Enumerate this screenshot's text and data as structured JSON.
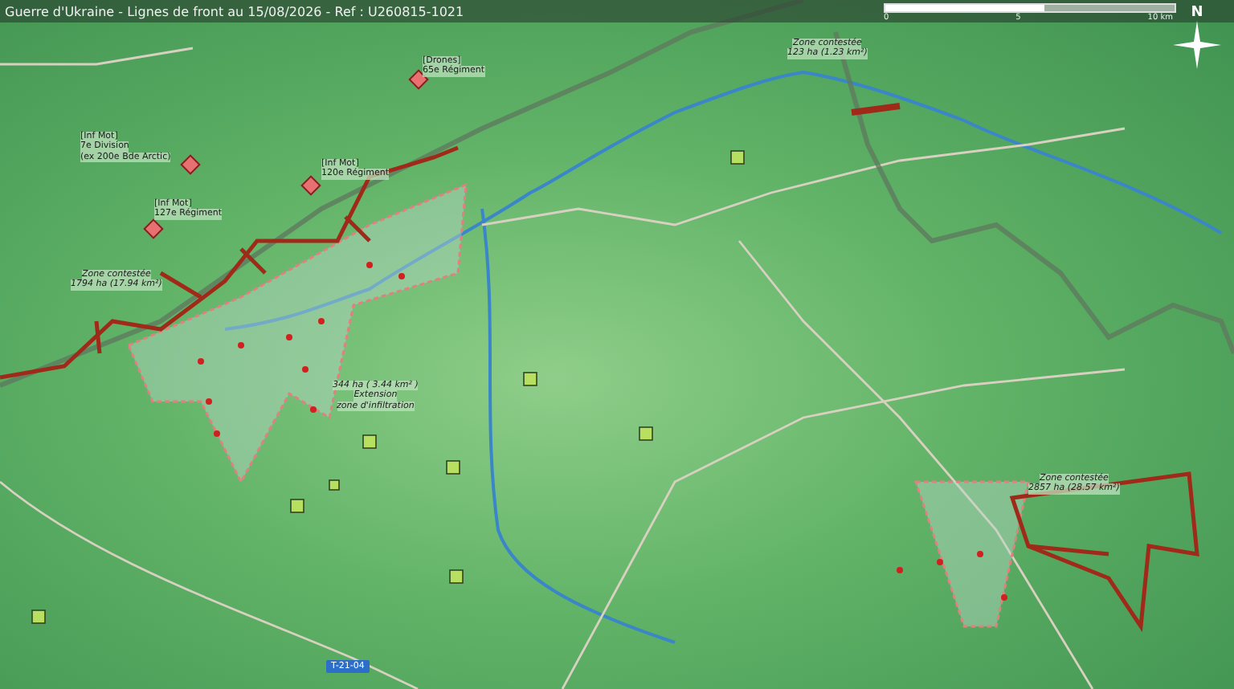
{
  "title": "Guerre d'Ukraine - Lignes de front au 15/08/2026 - Ref : U260815-1021",
  "scale": {
    "ticks": [
      "0",
      "5",
      "10 km"
    ]
  },
  "compass": {
    "label": "N"
  },
  "zones": [
    {
      "lines": [
        "Zone contestée",
        "123 ha (1.23 km²)"
      ]
    },
    {
      "lines": [
        "Zone contestée",
        "1794 ha (17.94 km²)"
      ]
    },
    {
      "lines": [
        "344 ha ( 3.44 km² )",
        "Extension",
        "zone d'infiltration"
      ]
    },
    {
      "lines": [
        "Zone contestée",
        "2857 ha (28.57 km²)"
      ]
    }
  ],
  "units": [
    {
      "kind": "enemy",
      "lines": [
        "[Drones]",
        "65e Régiment"
      ]
    },
    {
      "kind": "enemy",
      "lines": [
        "[Inf Mot]",
        "7e Division",
        "(ex 200e Bde Arctic)"
      ]
    },
    {
      "kind": "enemy",
      "lines": [
        "[Inf Mot]",
        "120e Régiment"
      ]
    },
    {
      "kind": "enemy",
      "lines": [
        "[Inf Mot]",
        "127e Régiment"
      ]
    }
  ],
  "road_badge": "T-21-04"
}
